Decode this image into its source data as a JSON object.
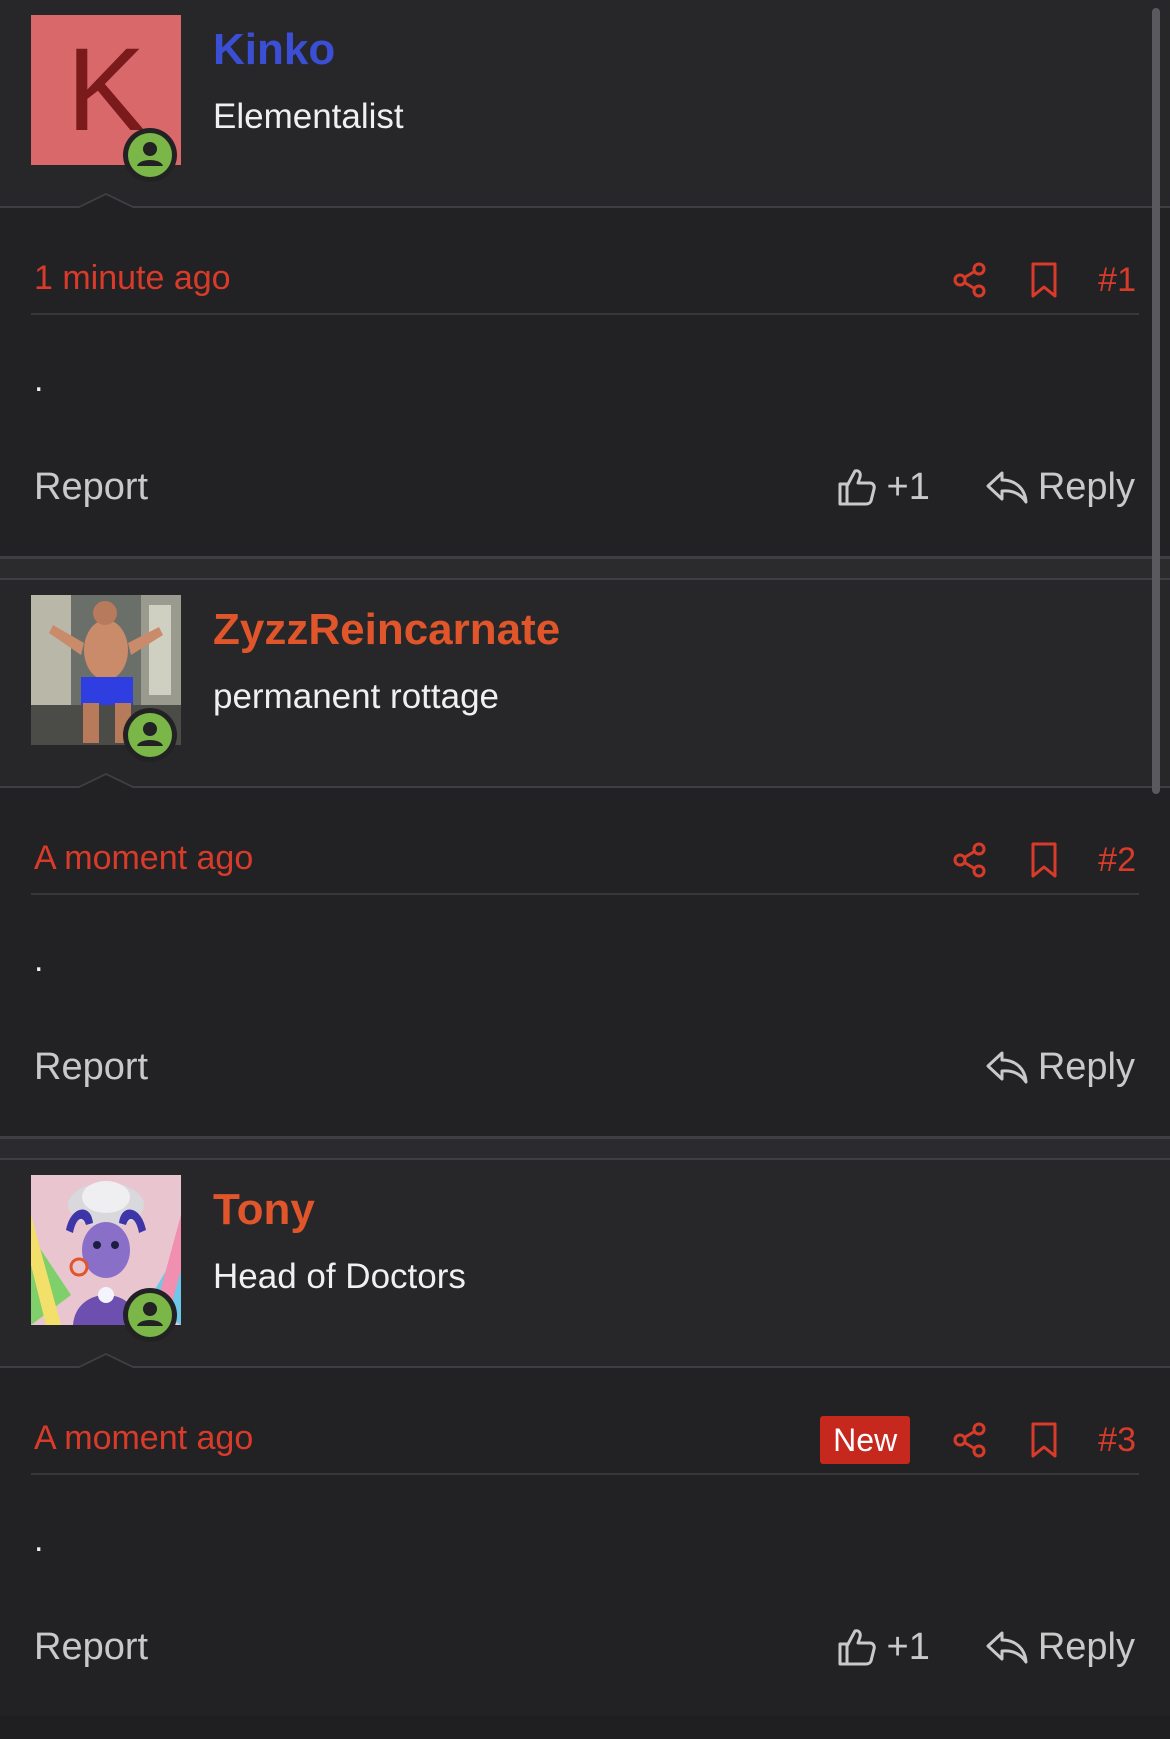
{
  "posts": [
    {
      "username": "Kinko",
      "username_color": "#3b4fd6",
      "user_title": "Elementalist",
      "avatar_letter": "K",
      "avatar_type": "letter",
      "timestamp": "1 minute ago",
      "new_badge": "",
      "post_number": "#1",
      "content": ".",
      "report_label": "Report",
      "reaction_label": "+1",
      "reply_label": "Reply",
      "show_reaction": true
    },
    {
      "username": "ZyzzReincarnate",
      "username_color": "#e0552a",
      "user_title": "permanent rottage",
      "avatar_type": "photo",
      "timestamp": "A moment ago",
      "new_badge": "",
      "post_number": "#2",
      "content": ".",
      "report_label": "Report",
      "reaction_label": "",
      "reply_label": "Reply",
      "show_reaction": false
    },
    {
      "username": "Tony",
      "username_color": "#e0552a",
      "user_title": "Head of Doctors",
      "avatar_type": "illustration",
      "timestamp": "A moment ago",
      "new_badge": "New",
      "post_number": "#3",
      "content": ".",
      "report_label": "Report",
      "reaction_label": "+1",
      "reply_label": "Reply",
      "show_reaction": true
    }
  ],
  "icons": {
    "share": "share-icon",
    "bookmark": "bookmark-icon",
    "thumbs_up": "thumbs-up-icon",
    "reply": "reply-icon",
    "online": "online-status-icon"
  },
  "colors": {
    "accent_red": "#d93b2b",
    "online_green": "#7ab648",
    "new_badge_bg": "#c6281e",
    "background": "#1f1f21"
  }
}
